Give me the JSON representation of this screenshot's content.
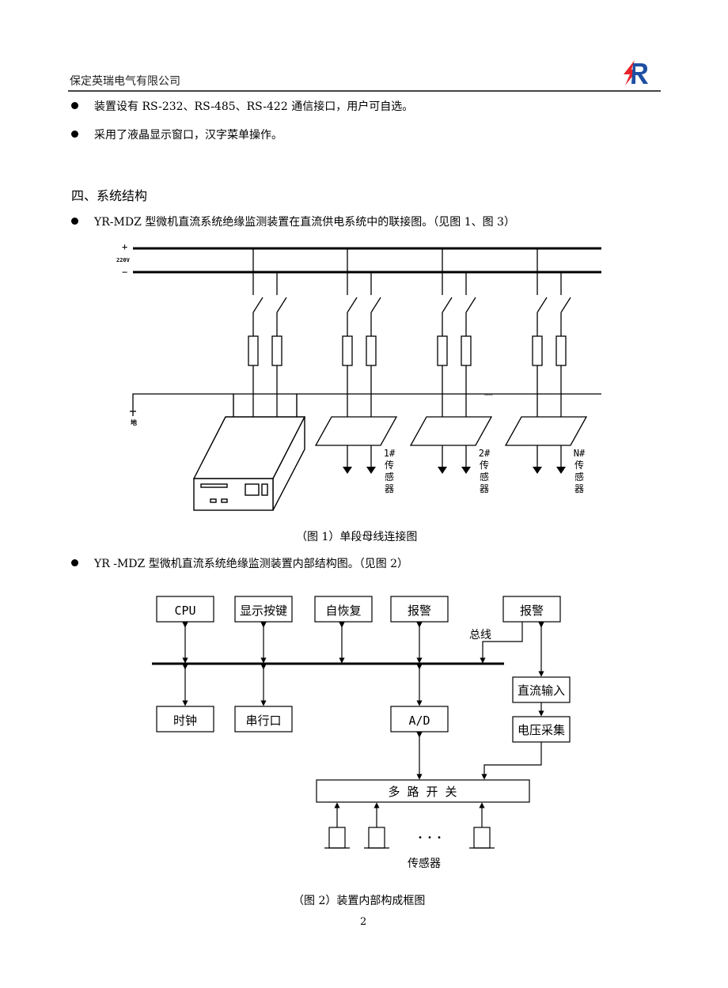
{
  "header": {
    "company": "保定英瑞电气有限公司",
    "logo": "yr-lightning-r-logo",
    "logo_colors": {
      "bolt": "#e8232a",
      "letter": "#1f4fa3"
    }
  },
  "bullets_top": [
    "装置设有 RS-232、RS-485、RS-422 通信接口，用户可自选。",
    "采用了液晶显示窗口，汉字菜单操作。"
  ],
  "section": {
    "title": "四、系统结构",
    "bullet1": "YR-MDZ 型微机直流系统绝缘监测装置在直流供电系统中的联接图。（见图 1、图 3）",
    "bullet2": "YR -MDZ 型微机直流系统绝缘监测装置内部结构图。（见图 2）"
  },
  "figure1": {
    "plus_label": "+",
    "voltage_label": "220V",
    "minus_label": "−",
    "ground_label": "地",
    "ellipsis": "……",
    "sensors": [
      {
        "id": "1#",
        "c1": "传",
        "c2": "感",
        "c3": "器"
      },
      {
        "id": "2#",
        "c1": "传",
        "c2": "感",
        "c3": "器"
      },
      {
        "id": "N#",
        "c1": "传",
        "c2": "感",
        "c3": "器"
      }
    ],
    "caption": "（图 1）单段母线连接图"
  },
  "figure2": {
    "blocks": {
      "cpu": "CPU",
      "display_keys": "显示按键",
      "self_recover": "自恢复",
      "alarm1": "报警",
      "alarm2": "报警",
      "clock": "时钟",
      "serial": "串行口",
      "ad": "A/D",
      "dc_input": "直流输入",
      "voltage_acq": "电压采集",
      "mux": "多 路 开 关"
    },
    "bus_label": "总线",
    "dots": "• • •",
    "sensor_label": "传感器",
    "caption": "（图 2）装置内部构成框图"
  },
  "page_number": "2"
}
